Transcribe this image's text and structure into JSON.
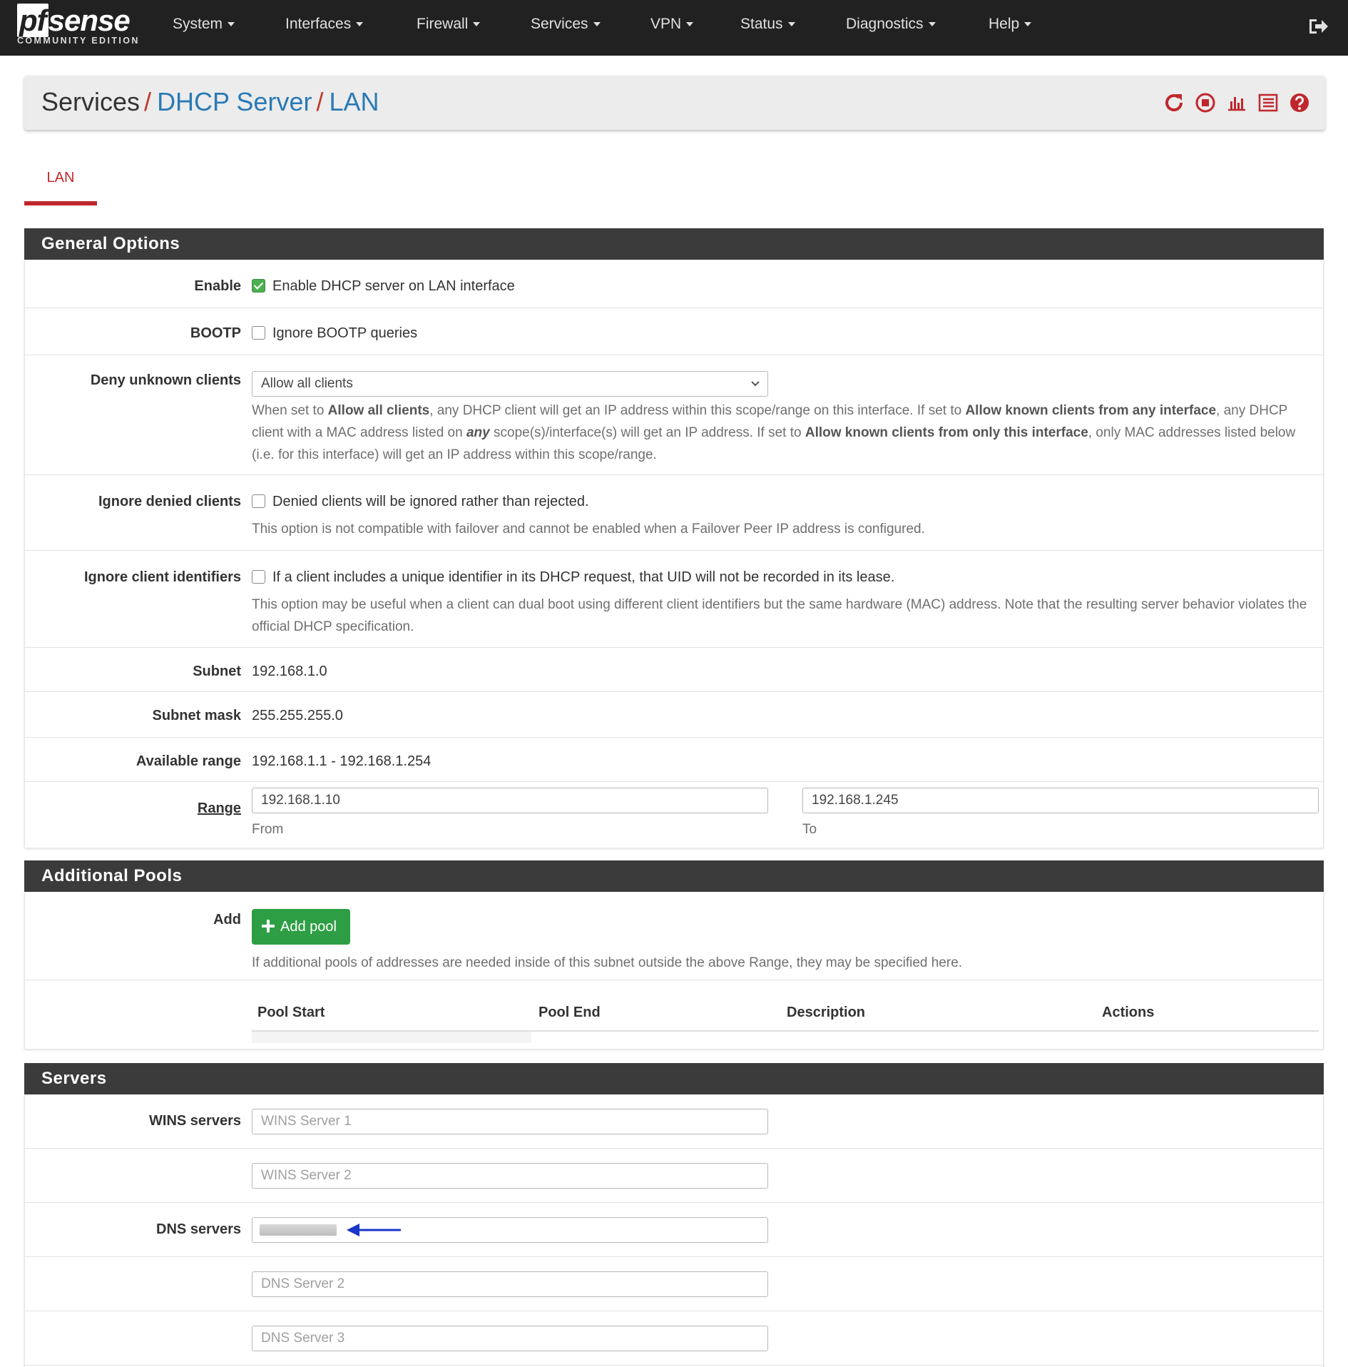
{
  "brand": {
    "logo_pf": "pf",
    "logo_rest": "sense",
    "edition": "COMMUNITY EDITION"
  },
  "nav": {
    "items": [
      "System",
      "Interfaces",
      "Firewall",
      "Services",
      "VPN",
      "Status",
      "Diagnostics",
      "Help"
    ]
  },
  "breadcrumb": {
    "root": "Services",
    "section": "DHCP Server",
    "page": "LAN"
  },
  "tabs": [
    {
      "label": "LAN",
      "active": true
    }
  ],
  "general": {
    "title": "General Options",
    "enable": {
      "label": "Enable",
      "text": "Enable DHCP server on LAN interface",
      "checked": true
    },
    "bootp": {
      "label": "BOOTP",
      "text": "Ignore BOOTP queries",
      "checked": false
    },
    "deny": {
      "label": "Deny unknown clients",
      "selected": "Allow all clients",
      "help_1": "When set to ",
      "help_b1": "Allow all clients",
      "help_2": ", any DHCP client will get an IP address within this scope/range on this interface. If set to ",
      "help_b2": "Allow known clients from any interface",
      "help_3": ", any DHCP client with a MAC address listed on ",
      "help_b3": "any",
      "help_4": " scope(s)/interface(s) will get an IP address. If set to ",
      "help_b4": "Allow known clients from only this interface",
      "help_5": ", only MAC addresses listed below (i.e. for this interface) will get an IP address within this scope/range."
    },
    "ignore_denied": {
      "label": "Ignore denied clients",
      "text": "Denied clients will be ignored rather than rejected.",
      "help": "This option is not compatible with failover and cannot be enabled when a Failover Peer IP address is configured.",
      "checked": false
    },
    "ignore_ids": {
      "label": "Ignore client identifiers",
      "text": "If a client includes a unique identifier in its DHCP request, that UID will not be recorded in its lease.",
      "help": "This option may be useful when a client can dual boot using different client identifiers but the same hardware (MAC) address. Note that the resulting server behavior violates the official DHCP specification.",
      "checked": false
    },
    "subnet": {
      "label": "Subnet",
      "value": "192.168.1.0"
    },
    "mask": {
      "label": "Subnet mask",
      "value": "255.255.255.0"
    },
    "available": {
      "label": "Available range",
      "value": "192.168.1.1 - 192.168.1.254"
    },
    "range": {
      "label": "Range",
      "from": "192.168.1.10",
      "to": "192.168.1.245",
      "from_label": "From",
      "to_label": "To"
    }
  },
  "pools": {
    "title": "Additional Pools",
    "add_label": "Add",
    "add_button": "Add pool",
    "help": "If additional pools of addresses are needed inside of this subnet outside the above Range, they may be specified here.",
    "columns": [
      "Pool Start",
      "Pool End",
      "Description",
      "Actions"
    ]
  },
  "servers": {
    "title": "Servers",
    "wins_label": "WINS servers",
    "wins1_placeholder": "WINS Server 1",
    "wins2_placeholder": "WINS Server 2",
    "dns_label": "DNS servers",
    "dns2_placeholder": "DNS Server 2",
    "dns3_placeholder": "DNS Server 3"
  },
  "colors": {
    "accent_red": "#c0272d",
    "link_blue": "#2a7ab5",
    "nav_bg": "#212121",
    "panel_head": "#3b3b3b",
    "green": "#2e9e44",
    "arrow_blue": "#1a35c9"
  }
}
